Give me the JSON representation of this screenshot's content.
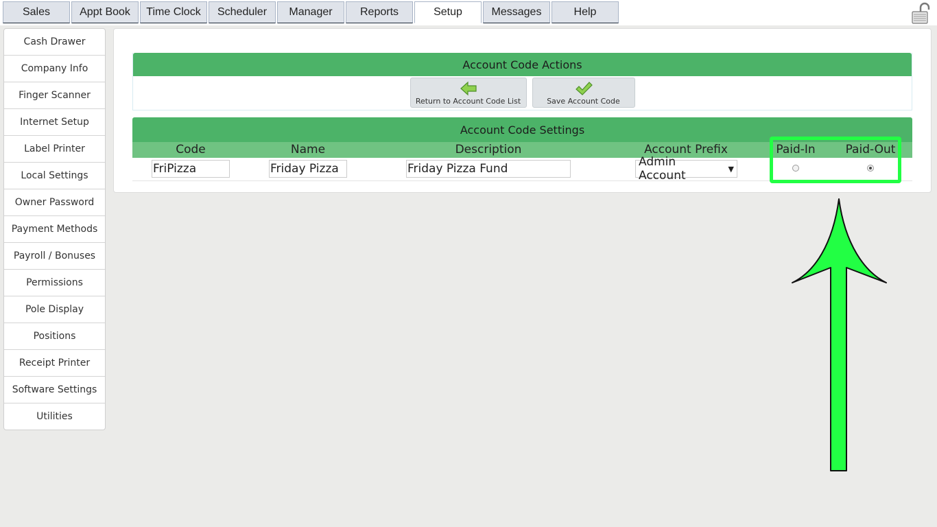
{
  "nav": {
    "tabs": [
      {
        "label": "Sales"
      },
      {
        "label": "Appt Book"
      },
      {
        "label": "Time Clock"
      },
      {
        "label": "Scheduler"
      },
      {
        "label": "Manager"
      },
      {
        "label": "Reports"
      },
      {
        "label": "Setup"
      },
      {
        "label": "Messages"
      },
      {
        "label": "Help"
      }
    ],
    "active_tab": "Setup",
    "lock_icon": "unlocked-padlock-icon"
  },
  "sidebar": {
    "items": [
      {
        "label": "Cash Drawer"
      },
      {
        "label": "Company Info"
      },
      {
        "label": "Finger Scanner"
      },
      {
        "label": "Internet Setup"
      },
      {
        "label": "Label Printer"
      },
      {
        "label": "Local Settings"
      },
      {
        "label": "Owner Password"
      },
      {
        "label": "Payment Methods"
      },
      {
        "label": "Payroll / Bonuses"
      },
      {
        "label": "Permissions"
      },
      {
        "label": "Pole Display"
      },
      {
        "label": "Positions"
      },
      {
        "label": "Receipt Printer"
      },
      {
        "label": "Software Settings"
      },
      {
        "label": "Utilities"
      }
    ]
  },
  "actions": {
    "title": "Account Code Actions",
    "return_button": {
      "label": "Return to Account Code List",
      "icon": "green-left-arrow-icon"
    },
    "save_button": {
      "label": "Save Account Code",
      "icon": "green-checkmark-icon"
    }
  },
  "settings": {
    "title": "Account Code Settings",
    "columns": {
      "code": "Code",
      "name": "Name",
      "description": "Description",
      "prefix": "Account Prefix",
      "paid_in": "Paid-In",
      "paid_out": "Paid-Out"
    },
    "row": {
      "code": "FriPizza",
      "name": "Friday Pizza",
      "description": "Friday Pizza Fund",
      "prefix": "Admin Account",
      "paid_in_selected": false,
      "paid_out_selected": true
    }
  },
  "annotation": {
    "color": "#22ff44"
  }
}
